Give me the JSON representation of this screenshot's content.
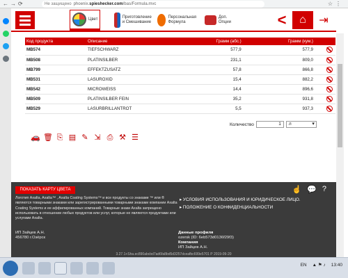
{
  "browser": {
    "security": "Не защищено",
    "url_prefix": "phoenix.",
    "url_domain": "spieshecker.com",
    "url_path": "/bas/Formula.mvc"
  },
  "toolbar": {
    "tools": [
      {
        "label": "Цвет",
        "icon": "color-search-icon",
        "active": true
      },
      {
        "label": "Приготовление и Смешивание",
        "icon": "mixing-cans-icon",
        "active": false
      },
      {
        "label": "Персональная Формула",
        "icon": "personal-formula-icon",
        "active": false
      },
      {
        "label": "Доп. Опции",
        "icon": "toolbox-icon",
        "active": false
      }
    ]
  },
  "table": {
    "headers": [
      "Код продукта",
      "Описание",
      "Грамм (абс.)",
      "Грамм (кум.)"
    ],
    "rows": [
      {
        "code": "MB574",
        "desc": "TIEFSCHWARZ",
        "abs": "577,9",
        "cum": "577,9"
      },
      {
        "code": "MB508",
        "desc": "PLATINSILBER",
        "abs": "231,1",
        "cum": "809,0"
      },
      {
        "code": "MB799",
        "desc": "EFFEKTZUSATZ",
        "abs": "57,8",
        "cum": "866,8"
      },
      {
        "code": "MB531",
        "desc": "LASUROXID",
        "abs": "15,4",
        "cum": "882,2"
      },
      {
        "code": "MB542",
        "desc": "MICROWEISS",
        "abs": "14,4",
        "cum": "896,6"
      },
      {
        "code": "MB509",
        "desc": "PLATINSILBER FEIN",
        "abs": "35,2",
        "cum": "931,8"
      },
      {
        "code": "MB529",
        "desc": "LASURBRILLANTROT",
        "abs": "5,5",
        "cum": "937,3"
      }
    ]
  },
  "quantity": {
    "label": "Количество",
    "value": "1",
    "unit": "л"
  },
  "footer": {
    "show_card_button": "ПОКАЗАТЬ КАРТУ ЦВЕТА",
    "legal_text": "Логотип Axalta, Axalta™ , Axalta Coating Systems™ и все продукты со знаками ™ или ® являются товарными знаками или зарегистрированными товарными знаками компании Axalta Coating Systems и ее аффилированных компаний. Товарные знаки Axalta запрещено использовать в отношении любых продуктов или услуг, которые не являются продуктами или услугами Axalta.",
    "link_terms": "УСЛОВИЯ ИСПОЛЬЗОВАНИЯ И ЮРИДИЧЕСКОЕ ЛИЦО.",
    "link_privacy": "ПОЛОЖЕНИЕ О КОНФИДЕНЦИАЛЬНОСТИ",
    "company_name": "ИП Зайцев А.Н.",
    "company_address": "456780 г.Озёрск",
    "profile_header": "Данные профиля",
    "profile_id": "ozersk (ID: 6eb573d0136f29f3)",
    "company_header": "Компания",
    "profile_company": "ИП Зайцев А.Н.",
    "version": "3.27.1+Sha.ec890abcbd7ad6fa8bd5d3257dceafbc699e5701 P 2019-09-20"
  },
  "taskbar": {
    "lang": "EN",
    "time": "13:40"
  }
}
